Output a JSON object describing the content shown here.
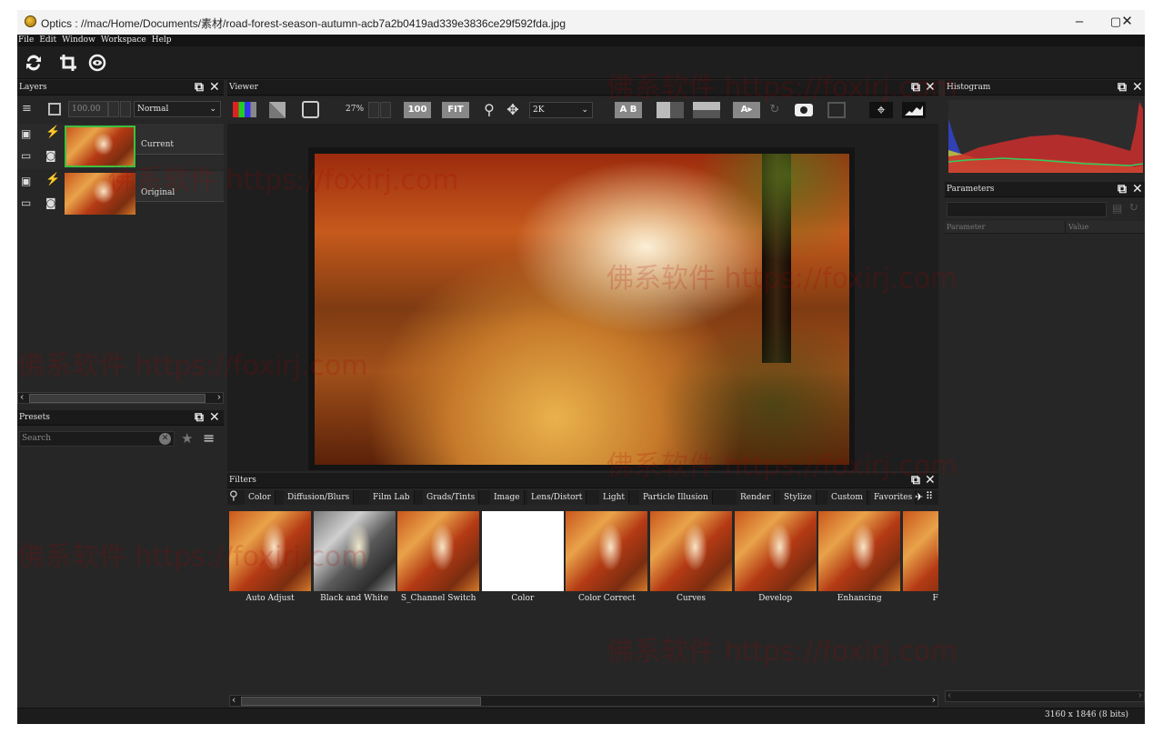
{
  "window": {
    "title": "Optics : //mac/Home/Documents/素材/road-forest-season-autumn-acb7a2b0419ad339e3836ce29f592fda.jpg",
    "minimize": "–",
    "maximize": "▢",
    "close": "✕"
  },
  "menu": [
    "File",
    "Edit",
    "Window",
    "Workspace",
    "Help"
  ],
  "toolbar": [
    "refresh-icon",
    "crop-icon",
    "rotate-view-icon"
  ],
  "layers": {
    "title": "Layers",
    "opacity": "100.00",
    "blend_mode": "Normal",
    "items": [
      {
        "label": "Current"
      },
      {
        "label": "Original"
      }
    ]
  },
  "presets": {
    "title": "Presets",
    "search_placeholder": "Search"
  },
  "viewer": {
    "title": "Viewer",
    "zoom": "27%",
    "btn_100": "100",
    "btn_fit": "FIT",
    "resolution": "2K",
    "ab": "A B",
    "a_btn": "A▸"
  },
  "histogram": {
    "title": "Histogram"
  },
  "parameters": {
    "title": "Parameters",
    "columns": [
      "Parameter",
      "Value"
    ]
  },
  "filters": {
    "title": "Filters",
    "tabs": [
      "Color",
      "Diffusion/Blurs",
      "Film Lab",
      "Grads/Tints",
      "Image",
      "Lens/Distort",
      "Light",
      "Particle Illusion",
      "Render",
      "Stylize",
      "Custom",
      "Favorites"
    ],
    "items": [
      {
        "label": "Auto Adjust",
        "style": "autumn"
      },
      {
        "label": "Black and White",
        "style": "bw"
      },
      {
        "label": "S_Channel Switch",
        "style": "autumn"
      },
      {
        "label": "Color",
        "style": "white"
      },
      {
        "label": "Color Correct",
        "style": "autumn"
      },
      {
        "label": "Curves",
        "style": "autumn"
      },
      {
        "label": "Develop",
        "style": "autumn"
      },
      {
        "label": "Enhancing",
        "style": "autumn"
      },
      {
        "label": "Fluor",
        "style": "autumn"
      }
    ]
  },
  "status": {
    "info": "3160 x 1846 (8 bits)"
  },
  "watermark": "佛系软件 https://foxirj.com",
  "colors": {
    "panel_bg": "#262626",
    "header_bg": "#1a1a1a",
    "current_layer_border": "#3fbf3f"
  }
}
